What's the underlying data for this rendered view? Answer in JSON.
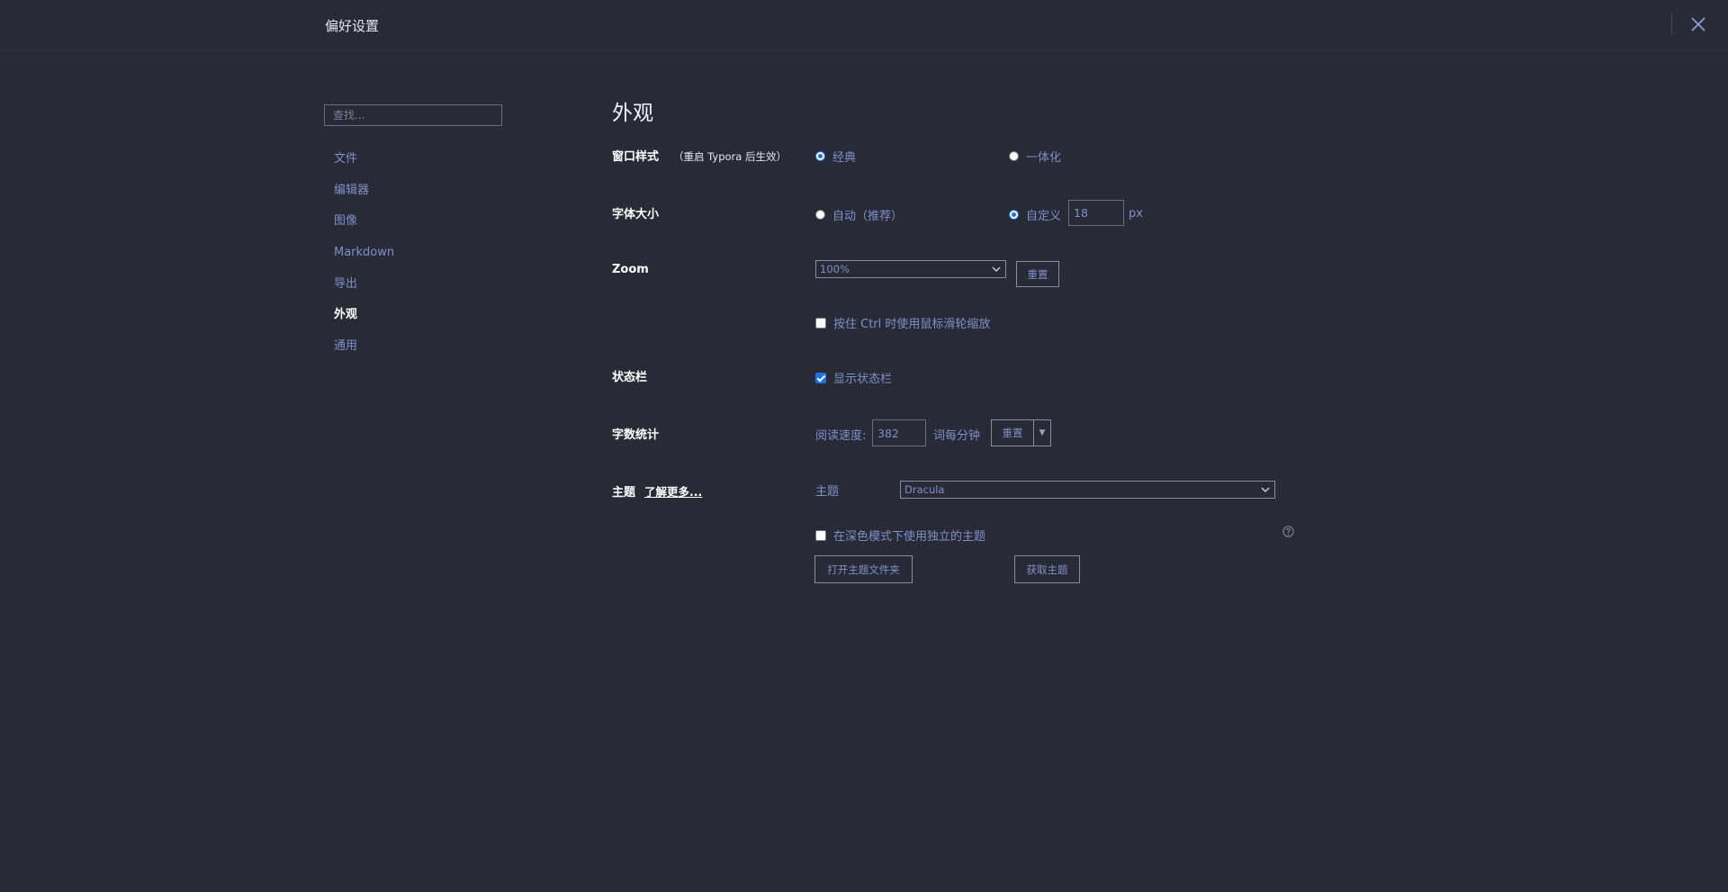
{
  "window": {
    "title": "偏好设置"
  },
  "sidebar": {
    "search_placeholder": "查找...",
    "items": [
      {
        "label": "文件"
      },
      {
        "label": "编辑器"
      },
      {
        "label": "图像"
      },
      {
        "label": "Markdown"
      },
      {
        "label": "导出"
      },
      {
        "label": "外观",
        "active": true
      },
      {
        "label": "通用"
      }
    ]
  },
  "main": {
    "title": "外观",
    "window_style": {
      "label": "窗口样式",
      "note": "（重启 Typora 后生效）",
      "option_classic": "经典",
      "option_unified": "一体化",
      "selected": "经典"
    },
    "font_size": {
      "label": "字体大小",
      "option_auto": "自动（推荐）",
      "option_custom": "自定义",
      "selected": "自定义",
      "value": "18",
      "unit": "px"
    },
    "zoom": {
      "label": "Zoom",
      "selected": "100%",
      "reset_label": "重置",
      "ctrl_wheel_label": "按住 Ctrl 时使用鼠标滑轮缩放",
      "ctrl_wheel_checked": false
    },
    "status_bar": {
      "label": "状态栏",
      "show_label": "显示状态栏",
      "checked": true
    },
    "word_count": {
      "label": "字数统计",
      "reading_speed_label": "阅读速度:",
      "reading_speed_value": "382",
      "unit_label": "词每分钟",
      "reset_label": "重置"
    },
    "theme": {
      "label": "主题",
      "learn_more": "了解更多...",
      "theme_label": "主题",
      "selected": "Dracula",
      "dark_mode_label": "在深色模式下使用独立的主题",
      "dark_mode_checked": false,
      "open_folder_label": "打开主题文件夹",
      "get_themes_label": "获取主题"
    }
  },
  "colors": {
    "background": "#282a36",
    "accent": "#7d90c8",
    "radio_selected": "#1a73e8"
  }
}
